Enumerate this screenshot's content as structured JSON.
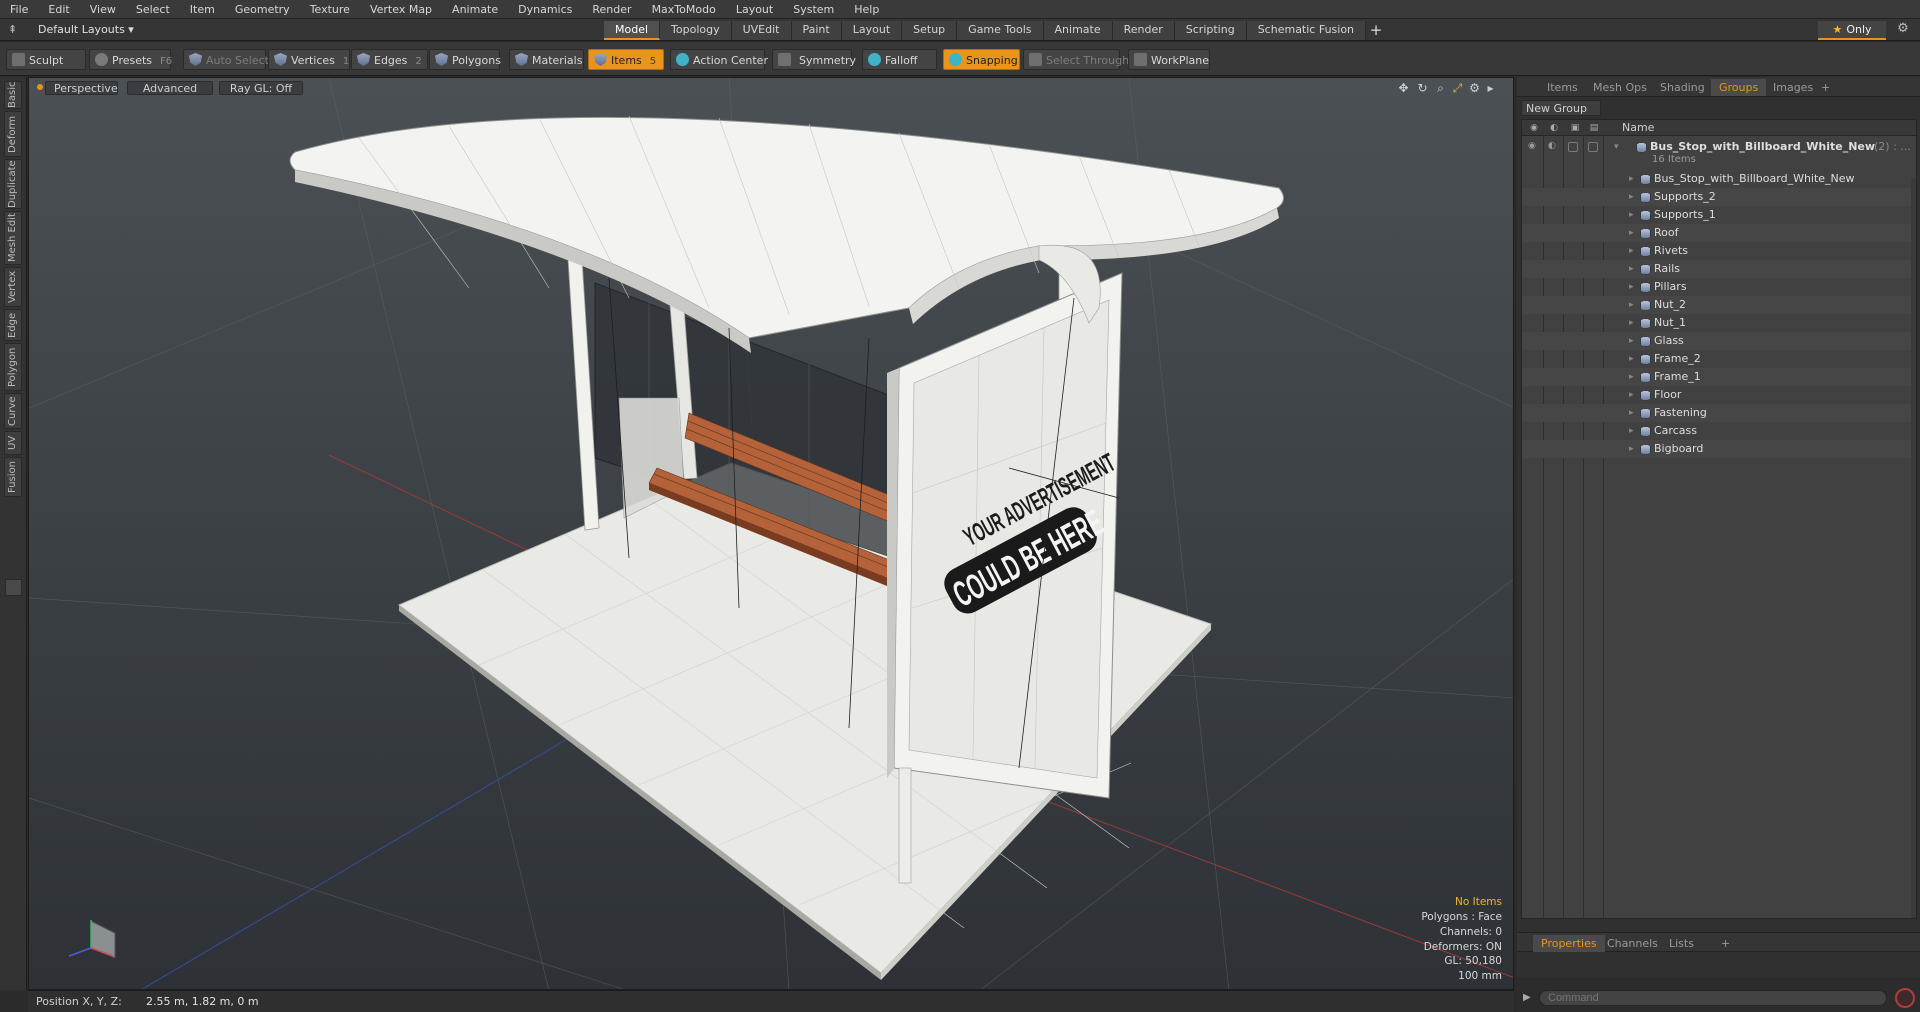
{
  "menu": [
    "File",
    "Edit",
    "View",
    "Select",
    "Item",
    "Geometry",
    "Texture",
    "Vertex Map",
    "Animate",
    "Dynamics",
    "Render",
    "MaxToModo",
    "Layout",
    "System",
    "Help"
  ],
  "layout": {
    "select_label": "Default Layouts ▾",
    "tabs": [
      "Model",
      "Topology",
      "UVEdit",
      "Paint",
      "Layout",
      "Setup",
      "Game Tools",
      "Animate",
      "Render",
      "Scripting",
      "Schematic Fusion"
    ],
    "active_tab": "Model",
    "plus": "+",
    "only_label": "Only"
  },
  "toolbar": {
    "sculpt": "Sculpt",
    "presets": "Presets",
    "presets_key": "F6",
    "auto_select": "Auto Select",
    "vertices": "Vertices",
    "vertices_key": "1",
    "edges": "Edges",
    "edges_key": "2",
    "polygons": "Polygons",
    "materials": "Materials",
    "items": "Items",
    "items_key": "5",
    "action_center": "Action Center",
    "symmetry": "Symmetry",
    "falloff": "Falloff",
    "snapping": "Snapping",
    "select_through": "Select Through",
    "workplane": "WorkPlane"
  },
  "left_strip": [
    "Basic",
    "Deform",
    "Duplicate",
    "Mesh Edit",
    "Vertex",
    "Edge",
    "Polygon",
    "Curve",
    "UV",
    "Fusion"
  ],
  "viewport": {
    "view_mode": "Perspective",
    "shading": "Advanced",
    "raygl": "Ray GL: Off",
    "billboard_line1": "YOUR ADVERTISEMENT",
    "billboard_line2": "COULD BE HERE",
    "info": {
      "no_items": "No Items",
      "polygons": "Polygons : Face",
      "channels": "Channels: 0",
      "deformers": "Deformers: ON",
      "gl": "GL: 50,180",
      "scale": "100 mm"
    }
  },
  "right_panel": {
    "tabs": [
      "Items",
      "Mesh Ops",
      "Shading",
      "Groups",
      "Images"
    ],
    "active_tab": "Groups",
    "plus": "+",
    "new_group": "New Group",
    "column_name": "Name",
    "root": {
      "label": "Bus_Stop_with_Billboard_White_New",
      "suffix": "(2) : ...",
      "count": "16 Items"
    },
    "children": [
      "Bus_Stop_with_Billboard_White_New",
      "Supports_2",
      "Supports_1",
      "Roof",
      "Rivets",
      "Rails",
      "Pillars",
      "Nut_2",
      "Nut_1",
      "Glass",
      "Frame_2",
      "Frame_1",
      "Floor",
      "Fastening",
      "Carcass",
      "Bigboard"
    ],
    "bottom_tabs": [
      "Properties",
      "Channels",
      "Lists"
    ],
    "bottom_active": "Properties",
    "command_placeholder": "Command"
  },
  "status": {
    "label": "Position X, Y, Z:",
    "value": "2.55 m, 1.82 m, 0 m"
  },
  "colors": {
    "accent": "#e8961b",
    "bench_wood": "#b4623a"
  }
}
